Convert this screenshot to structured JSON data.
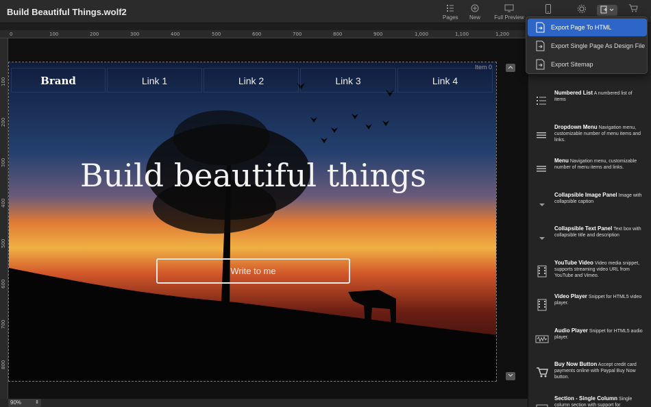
{
  "window": {
    "title": "Build Beautiful Things.wolf2"
  },
  "toolbar": {
    "pages_label": "Pages",
    "new_label": "New",
    "full_preview_label": "Full Preview"
  },
  "export_menu": {
    "items": [
      {
        "label": "Export Page To HTML",
        "active": true
      },
      {
        "label": "Export Single Page As Design File",
        "active": false
      },
      {
        "label": "Export Sitemap",
        "active": false
      }
    ]
  },
  "rulers": {
    "top_ticks": [
      "0",
      "100",
      "200",
      "300",
      "400",
      "500",
      "600",
      "700",
      "800",
      "900",
      "1,000",
      "1,100",
      "1,200"
    ],
    "left_ticks": [
      "100",
      "200",
      "300",
      "400",
      "500",
      "600",
      "700",
      "800"
    ]
  },
  "page": {
    "item_label": "Item 0",
    "nav": {
      "brand": "Brand",
      "links": [
        "Link 1",
        "Link 2",
        "Link 3",
        "Link 4"
      ]
    },
    "hero_title": "Build beautiful things",
    "cta_label": "Write to me"
  },
  "status": {
    "zoom": "90%"
  },
  "snippets": [
    {
      "title": "Numbered List",
      "desc": "A numbered list of items",
      "icon": "numbered-list-icon"
    },
    {
      "title": "Dropdown Menu",
      "desc": "Navigation menu, customizable number of menu items and links.",
      "icon": "menu-icon"
    },
    {
      "title": "Menu",
      "desc": "Navigation menu, customizable number of menu items and links.",
      "icon": "menu-icon"
    },
    {
      "title": "Collapsible Image Panel",
      "desc": "Image with collapsible caption",
      "icon": "triangle-down-icon"
    },
    {
      "title": "Collapsible Text Panel",
      "desc": "Text box with collapsible title and description",
      "icon": "triangle-down-icon"
    },
    {
      "title": "YouTube Video",
      "desc": "Video media snippet, supports streaming video URL from YouTube and Vimeo.",
      "icon": "film-icon"
    },
    {
      "title": "Video Player",
      "desc": "Snippet for HTML5 video player.",
      "icon": "film-icon"
    },
    {
      "title": "Audio Player",
      "desc": "Snippet for HTML5 audio player.",
      "icon": "audio-icon"
    },
    {
      "title": "Buy Now Button",
      "desc": "Accept credit card payments online with Paypal Buy Now button.",
      "icon": "cart-icon"
    },
    {
      "title": "Section - Single Column",
      "desc": "Single column section with support for",
      "icon": "section-icon"
    }
  ]
}
